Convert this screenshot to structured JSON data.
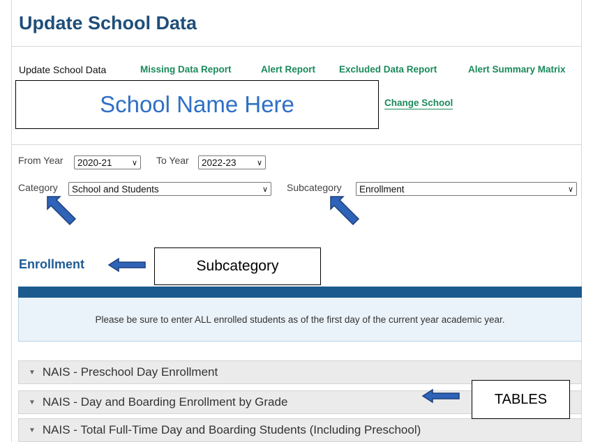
{
  "header": {
    "title": "Update School Data"
  },
  "tabs": [
    {
      "label": "Update School Data",
      "active": true
    },
    {
      "label": "Missing Data Report",
      "active": false
    },
    {
      "label": "Alert Report",
      "active": false
    },
    {
      "label": "Excluded Data Report",
      "active": false
    },
    {
      "label": "Alert Summary Matrix",
      "active": false
    }
  ],
  "school": {
    "name_placeholder": "School Name Here",
    "change_label": "Change School"
  },
  "filters": {
    "from_year_label": "From Year",
    "from_year_value": "2020-21",
    "to_year_label": "To Year",
    "to_year_value": "2022-23",
    "category_label": "Category",
    "category_value": "School and Students",
    "subcategory_label": "Subcategory",
    "subcategory_value": "Enrollment"
  },
  "section": {
    "heading": "Enrollment",
    "notice": "Please be sure to enter ALL enrolled students as of the first day of the current year academic year."
  },
  "annotations": {
    "subcategory": "Subcategory",
    "tables": "TABLES"
  },
  "tables": [
    {
      "title": "NAIS - Preschool Day Enrollment"
    },
    {
      "title": "NAIS - Day and Boarding Enrollment by Grade"
    },
    {
      "title": "NAIS - Total Full-Time Day and Boarding Students (Including Preschool)"
    }
  ],
  "colors": {
    "title": "#1f4e79",
    "link": "#1a8a5a",
    "annotation_arrow": "#2e63b8",
    "band": "#1b5a8e"
  }
}
